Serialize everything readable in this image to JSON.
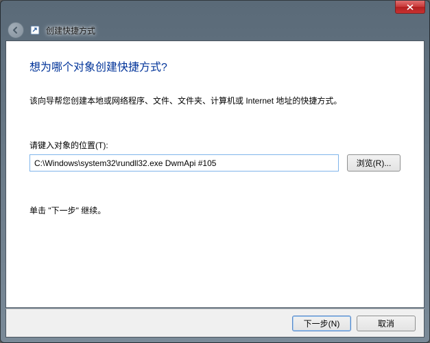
{
  "titlebar": {
    "close_icon": "close"
  },
  "header": {
    "title": "创建快捷方式"
  },
  "content": {
    "heading": "想为哪个对象创建快捷方式?",
    "description": "该向导帮您创建本地或网络程序、文件、文件夹、计算机或 Internet 地址的快捷方式。",
    "field_label": "请键入对象的位置(T):",
    "path_value": "C:\\Windows\\system32\\rundll32.exe DwmApi #105",
    "browse_label": "浏览(R)...",
    "hint": "单击 \"下一步\" 继续。"
  },
  "footer": {
    "next_label": "下一步(N)",
    "cancel_label": "取消"
  }
}
